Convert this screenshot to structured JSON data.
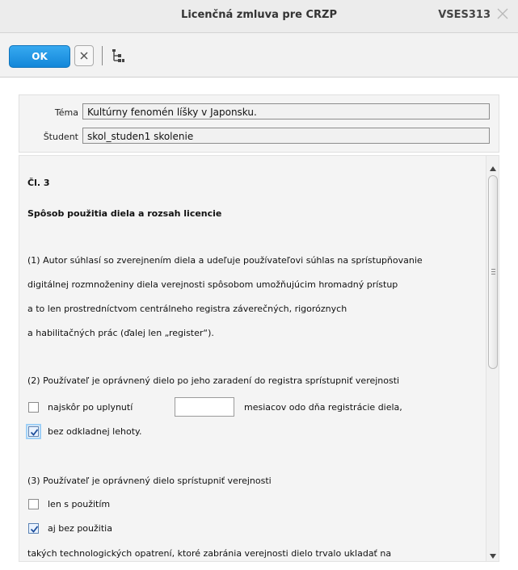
{
  "window": {
    "title": "Licenčná zmluva pre CRZP",
    "code": "VSES313"
  },
  "toolbar": {
    "ok_label": "OK",
    "cancel_icon": "close-icon",
    "tree_icon": "tree-structure-icon"
  },
  "form": {
    "tema_label": "Téma",
    "tema_value": "Kultúrny fenomén líšky v Japonsku.",
    "student_label": "Študent",
    "student_value": "skol_studen1 skolenie"
  },
  "doc": {
    "article": "Čl. 3",
    "heading": "Spôsob použitia diela a rozsah licencie",
    "p1": [
      "(1) Autor súhlasí so zverejnením diela a udeľuje používateľovi súhlas na sprístupňovanie",
      "digitálnej rozmnoženiny diela verejnosti spôsobom umožňujúcim hromadný prístup",
      "a to len prostredníctvom centrálneho registra záverečných, rigoróznych",
      "a habilitačných prác (ďalej len „register“)."
    ],
    "p2": "(2) Používateľ je oprávnený dielo po jeho zaradení do registra sprístupniť verejnosti",
    "opt_najskor": "najskôr po uplynutí",
    "months_value": "",
    "opt_mesiacov": "mesiacov odo dňa registrácie diela,",
    "opt_bez": "bez odkladnej lehoty.",
    "p3": "(3) Používateľ je oprávnený dielo sprístupniť verejnosti",
    "opt_len": "len s použitím",
    "opt_aj": "aj bez použitia",
    "p3_tail": "takých technologických opatrení, ktoré zabránia verejnosti dielo trvalo ukladať na",
    "checkbox_states": {
      "najskor": false,
      "bez": true,
      "len": false,
      "aj": true
    }
  },
  "colors": {
    "ok_button": "#1a8fe0",
    "titlebar": "#ececec"
  }
}
